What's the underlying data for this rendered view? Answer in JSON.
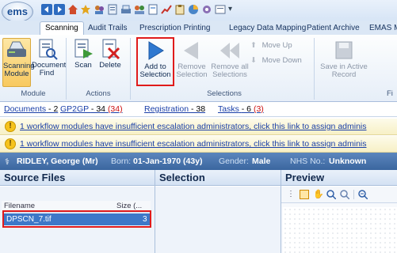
{
  "app": {
    "logo_text": "ems"
  },
  "tabs": [
    "Scanning",
    "Audit Trails",
    "Prescription Printing",
    "Legacy Data Mapping",
    "Patient Archive",
    "EMAS M"
  ],
  "ribbon": {
    "buttons": {
      "scanning_module": "Scanning Module",
      "document_find": "Document Find",
      "scan": "Scan",
      "delete": "Delete",
      "add_to_selection": "Add to Selection",
      "remove_selection": "Remove Selection",
      "remove_all_selections": "Remove all Selections",
      "move_up": "Move Up",
      "move_down": "Move Down",
      "save_in_active_record": "Save in Active Record"
    },
    "groups": {
      "module": "Module",
      "actions": "Actions",
      "selections": "Selections",
      "partial": "Fi"
    }
  },
  "links": {
    "documents": "Documents",
    "documents_count": "- 2",
    "gp2gp": "GP2GP",
    "gp2gp_count": "- 34",
    "gp2gp_red": "(34)",
    "registration": "Registration",
    "registration_count": "- 38",
    "tasks": "Tasks",
    "tasks_count": "- 6",
    "tasks_red": "(3)"
  },
  "warnings": [
    "1 workflow modules have insufficient escalation administrators, click this link to assign adminis",
    "1 workflow modules have insufficient escalation administrators, click this link to assign adminis"
  ],
  "patient": {
    "name": "RIDLEY, George (Mr)",
    "born_label": "Born:",
    "born_value": "01-Jan-1970 (43y)",
    "gender_label": "Gender:",
    "gender_value": "Male",
    "nhs_label": "NHS No.:",
    "nhs_value": "Unknown"
  },
  "panes": {
    "source_files": "Source Files",
    "selection": "Selection",
    "preview": "Preview",
    "columns": {
      "filename": "Filename",
      "size": "Size (..."
    },
    "files": [
      {
        "name": "DPSCN_7.tif",
        "size": "3"
      }
    ]
  },
  "colors": {
    "highlight_box": "#e01b1b",
    "selected_row": "#3d78c8",
    "patient_banner": "#3b669f"
  }
}
